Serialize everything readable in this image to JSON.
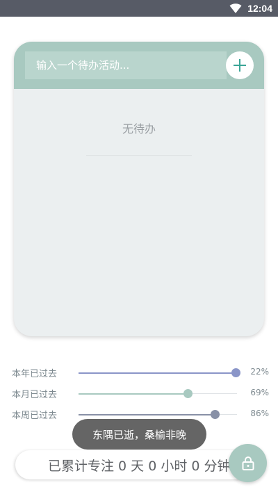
{
  "status_bar": {
    "time": "12:04",
    "wifi_icon": "wifi-icon"
  },
  "todo": {
    "input_placeholder": "输入一个待办活动...",
    "add_icon": "plus-icon",
    "empty_text": "无待办"
  },
  "progress": [
    {
      "label": "本年已过去",
      "percent_text": "22%",
      "fraction": 0.99,
      "color": "#8a95c8"
    },
    {
      "label": "本月已过去",
      "percent_text": "69%",
      "fraction": 0.69,
      "color": "#a8c9c0"
    },
    {
      "label": "本周已过去",
      "percent_text": "86%",
      "fraction": 0.86,
      "color": "#8890a6"
    }
  ],
  "toast": {
    "text": "东隅已逝，桑榆非晚"
  },
  "focus": {
    "summary": "已累计专注 0 天 0 小时 0 分钟"
  },
  "lock_icon": "lock-icon",
  "colors": {
    "accent": "#a8c9c0",
    "plus": "#3aa597",
    "status_bar": "#575b66"
  }
}
